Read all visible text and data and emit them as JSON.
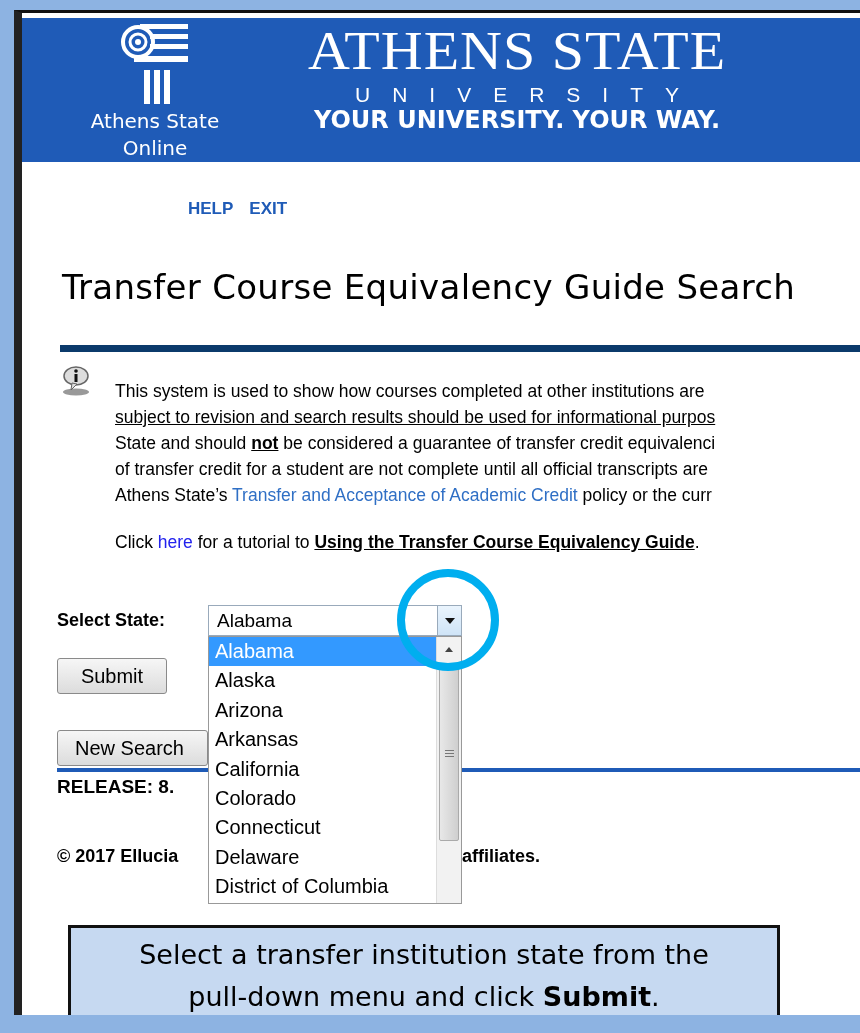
{
  "header": {
    "logo_caption": "Athens State Online",
    "title": "ATHENS STATE",
    "subtitle": "UNIVERSITY",
    "tagline": "YOUR UNIVERSITY. YOUR WAY."
  },
  "nav_links": [
    "HELP",
    "EXIT"
  ],
  "page_title": "Transfer Course Equivalency Guide Search",
  "info_lines": [
    [
      {
        "kind": "plain",
        "text": "This system is used to show how courses completed at other institutions are"
      }
    ],
    [
      {
        "kind": "underline",
        "text": "subject to revision and search results should be used for informational purpos"
      }
    ],
    [
      {
        "kind": "plain",
        "text": "State and should "
      },
      {
        "kind": "bold",
        "text": "not"
      },
      {
        "kind": "plain",
        "text": " be considered a guarantee of transfer credit equivalenci"
      }
    ],
    [
      {
        "kind": "plain",
        "text": "of transfer credit for a student are not complete until all official transcripts are"
      }
    ],
    [
      {
        "kind": "plain",
        "text": "Athens State’s "
      },
      {
        "kind": "link",
        "text": "Transfer and Acceptance of Academic Credit"
      },
      {
        "kind": "plain",
        "text": " policy or the curr"
      }
    ]
  ],
  "tutorial_line": [
    {
      "kind": "plain",
      "text": "Click "
    },
    {
      "kind": "link",
      "text": "here"
    },
    {
      "kind": "plain",
      "text": " for a tutorial to "
    },
    {
      "kind": "bold",
      "text": "Using the Transfer Course Equivalency Guide"
    },
    {
      "kind": "plain",
      "text": "."
    }
  ],
  "state_select": {
    "label": "Select State:",
    "value": "Alabama",
    "expanded": true,
    "options": [
      {
        "label": "Alabama",
        "selected": true
      },
      {
        "label": "Alaska",
        "selected": false
      },
      {
        "label": "Arizona",
        "selected": false
      },
      {
        "label": "Arkansas",
        "selected": false
      },
      {
        "label": "California",
        "selected": false
      },
      {
        "label": "Colorado",
        "selected": false
      },
      {
        "label": "Connecticut",
        "selected": false
      },
      {
        "label": "Delaware",
        "selected": false
      },
      {
        "label": "District of Columbia",
        "selected": false
      }
    ]
  },
  "buttons": [
    "Submit",
    "New Search"
  ],
  "release": "RELEASE: 8.",
  "copyright": {
    "left": "© 2017 Ellucia",
    "right": "affiliates."
  },
  "callout": [
    "Select a transfer institution state from the",
    "pull-down menu and click **Submit**."
  ]
}
